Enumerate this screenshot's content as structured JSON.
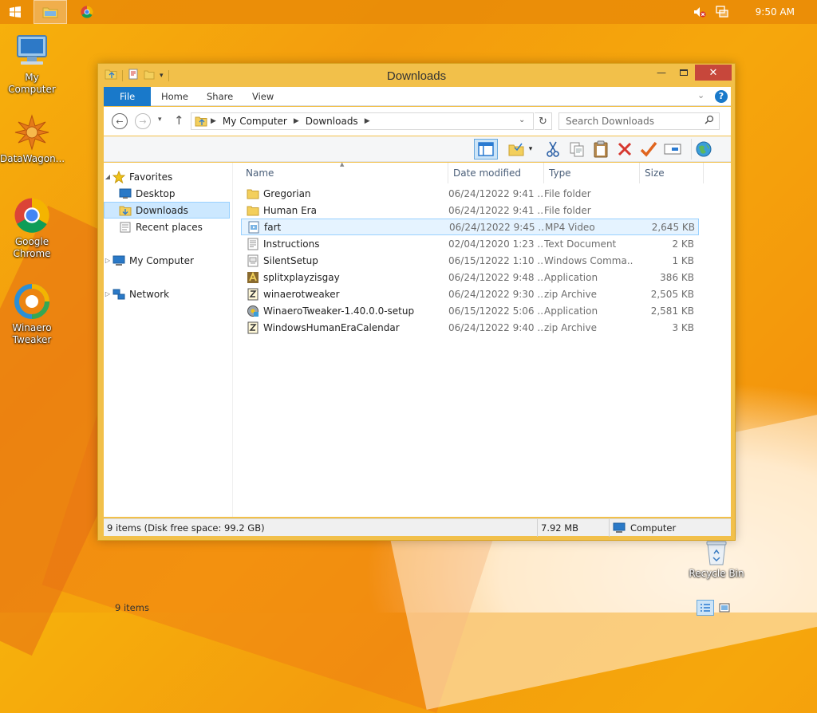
{
  "taskbar": {
    "clock": "9:50 AM"
  },
  "desktop": {
    "icons": [
      {
        "label": "My Computer"
      },
      {
        "label": "DataWagon..."
      },
      {
        "label": "Google Chrome"
      },
      {
        "label": "Winaero Tweaker"
      },
      {
        "label": "Recycle Bin"
      }
    ]
  },
  "window": {
    "title": "Downloads",
    "ribbon": {
      "tabs": [
        "File",
        "Home",
        "Share",
        "View"
      ]
    },
    "address": {
      "crumbs": [
        "My Computer",
        "Downloads"
      ]
    },
    "search": {
      "placeholder": "Search Downloads"
    },
    "navpane": {
      "favorites": "Favorites",
      "desktop": "Desktop",
      "downloads": "Downloads",
      "recent": "Recent places",
      "computer": "My Computer",
      "network": "Network"
    },
    "columns": {
      "name": "Name",
      "date": "Date modified",
      "type": "Type",
      "size": "Size"
    },
    "files": [
      {
        "name": "Gregorian",
        "date": "06/24/12022 9:41 ...",
        "type": "File folder",
        "size": "",
        "icon": "folder-icon"
      },
      {
        "name": "Human Era",
        "date": "06/24/12022 9:41 ...",
        "type": "File folder",
        "size": "",
        "icon": "folder-icon"
      },
      {
        "name": "fart",
        "date": "06/24/12022 9:45 ...",
        "type": "MP4 Video",
        "size": "2,645 KB",
        "icon": "video-file-icon"
      },
      {
        "name": "Instructions",
        "date": "02/04/12020 1:23 ...",
        "type": "Text Document",
        "size": "2 KB",
        "icon": "text-file-icon"
      },
      {
        "name": "SilentSetup",
        "date": "06/15/12022 1:10 ...",
        "type": "Windows Comma...",
        "size": "1 KB",
        "icon": "batch-file-icon"
      },
      {
        "name": "splitxplayzisgay",
        "date": "06/24/12022 9:48 ...",
        "type": "Application",
        "size": "386 KB",
        "icon": "application-icon"
      },
      {
        "name": "winaerotweaker",
        "date": "06/24/12022 9:30 ...",
        "type": "zip Archive",
        "size": "2,505 KB",
        "icon": "zip-archive-icon"
      },
      {
        "name": "WinaeroTweaker-1.40.0.0-setup",
        "date": "06/15/12022 5:06 ...",
        "type": "Application",
        "size": "2,581 KB",
        "icon": "setup-icon"
      },
      {
        "name": "WindowsHumanEraCalendar",
        "date": "06/24/12022 9:40 ...",
        "type": "zip Archive",
        "size": "3 KB",
        "icon": "zip-archive-icon"
      }
    ],
    "selected_file": "fart",
    "item_count": "9 items",
    "status": {
      "left": "9 items (Disk free space: 99.2 GB)",
      "size": "7.92 MB",
      "location": "Computer"
    }
  },
  "colors": {
    "accent": "#1979ca",
    "close_button": "#c7473b",
    "selection": "#cce8ff",
    "desktop": "#f5a20c"
  }
}
